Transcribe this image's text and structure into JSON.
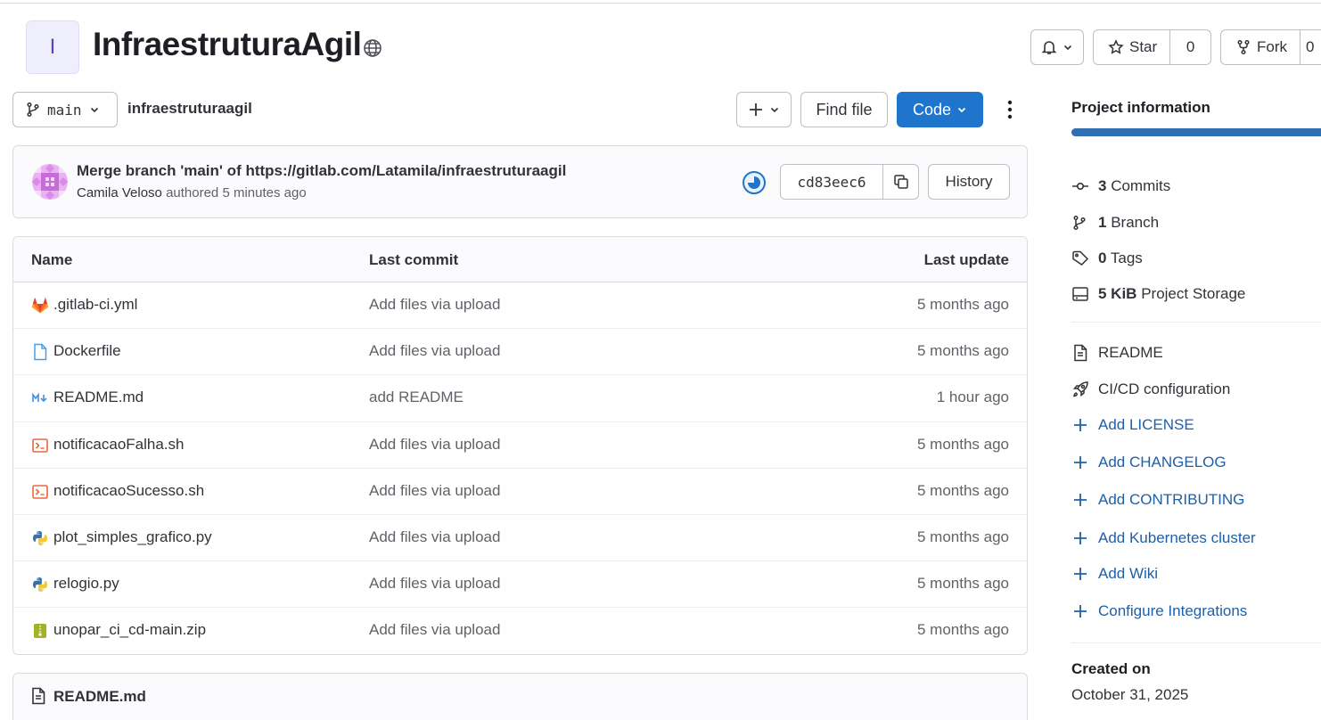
{
  "project": {
    "avatar_letter": "I",
    "name": "InfraestruturaAgil",
    "visibility_icon": "globe-icon"
  },
  "header_actions": {
    "star_label": "Star",
    "star_count": "0",
    "fork_label": "Fork",
    "fork_count": "0"
  },
  "toolbar": {
    "branch": "main",
    "breadcrumb": "infraestruturaagil",
    "find_file_label": "Find file",
    "code_label": "Code"
  },
  "last_commit": {
    "title": "Merge branch 'main' of https://gitlab.com/Latamila/infraestruturaagil",
    "author": "Camila Veloso",
    "action": "authored",
    "time": "5 minutes ago",
    "sha": "cd83eec6",
    "history_label": "History"
  },
  "file_table": {
    "columns": [
      "Name",
      "Last commit",
      "Last update"
    ],
    "rows": [
      {
        "name": ".gitlab-ci.yml",
        "icon": "gitlab-icon",
        "commit": "Add files via upload",
        "updated": "5 months ago"
      },
      {
        "name": "Dockerfile",
        "icon": "file-icon",
        "commit": "Add files via upload",
        "updated": "5 months ago"
      },
      {
        "name": "README.md",
        "icon": "markdown-icon",
        "commit": "add README",
        "updated": "1 hour ago"
      },
      {
        "name": "notificacaoFalha.sh",
        "icon": "terminal-icon",
        "commit": "Add files via upload",
        "updated": "5 months ago"
      },
      {
        "name": "notificacaoSucesso.sh",
        "icon": "terminal-icon",
        "commit": "Add files via upload",
        "updated": "5 months ago"
      },
      {
        "name": "plot_simples_grafico.py",
        "icon": "python-icon",
        "commit": "Add files via upload",
        "updated": "5 months ago"
      },
      {
        "name": "relogio.py",
        "icon": "python-icon",
        "commit": "Add files via upload",
        "updated": "5 months ago"
      },
      {
        "name": "unopar_ci_cd-main.zip",
        "icon": "archive-icon",
        "commit": "Add files via upload",
        "updated": "5 months ago"
      }
    ]
  },
  "readme": {
    "title": "README.md"
  },
  "sidebar": {
    "title": "Project information",
    "stats": [
      {
        "count": "3",
        "label": "Commits",
        "icon": "commit-icon"
      },
      {
        "count": "1",
        "label": "Branch",
        "icon": "branch-icon"
      },
      {
        "count": "0",
        "label": "Tags",
        "icon": "tag-icon"
      },
      {
        "count": "5 KiB",
        "label": "Project Storage",
        "icon": "storage-icon"
      }
    ],
    "links": [
      {
        "label": "README",
        "icon": "document-icon"
      },
      {
        "label": "CI/CD configuration",
        "icon": "rocket-icon"
      },
      {
        "label": "Add LICENSE",
        "icon": "plus-icon"
      },
      {
        "label": "Add CHANGELOG",
        "icon": "plus-icon"
      },
      {
        "label": "Add CONTRIBUTING",
        "icon": "plus-icon"
      },
      {
        "label": "Add Kubernetes cluster",
        "icon": "plus-icon"
      },
      {
        "label": "Add Wiki",
        "icon": "plus-icon"
      },
      {
        "label": "Configure Integrations",
        "icon": "plus-icon"
      }
    ],
    "created_label": "Created on",
    "created_value": "October 31, 2025"
  },
  "colors": {
    "primary_button": "#1f75cb",
    "link": "#1f5fa8",
    "sidebar_bar": "#2f6fb0"
  }
}
